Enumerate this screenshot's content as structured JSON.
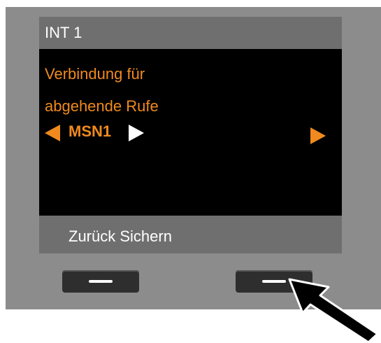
{
  "header": {
    "title": "INT 1"
  },
  "display": {
    "line1": "Verbindung für",
    "line2": "abgehende Rufe",
    "selected_value": "MSN1"
  },
  "softkeys": {
    "text": "Zurück Sichern"
  },
  "colors": {
    "accent": "#f08a1e",
    "display_bg": "#000000",
    "bar_bg": "#6f6f6f",
    "bezel": "#8c8c8c"
  },
  "icons": {
    "left_arrow": "left-arrow-icon",
    "right_arrow_white": "right-arrow-icon",
    "right_arrow_orange": "right-arrow-icon",
    "pointer": "hand-pointer-arrow-icon"
  }
}
